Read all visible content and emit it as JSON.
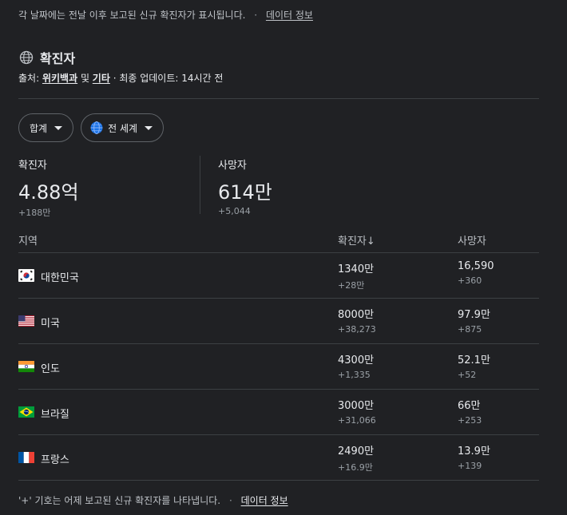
{
  "top_note": {
    "text": "각 날짜에는 전날 이후 보고된 신규 확진자가 표시됩니다.",
    "separator": "·",
    "link": "데이터 정보"
  },
  "header": {
    "icon": "globe-icon",
    "title": "확진자",
    "source_prefix": "출처: ",
    "source_link_1": "위키백과",
    "source_and": " 및 ",
    "source_link_2": "기타",
    "source_suffix": " · 최종 업데이트: 14시간 전"
  },
  "chips": {
    "total_label": "합계",
    "region_label": "전 세계"
  },
  "summary": {
    "cases": {
      "label": "확진자",
      "value": "4.88억",
      "delta": "+188만"
    },
    "deaths": {
      "label": "사망자",
      "value": "614만",
      "delta": "+5,044"
    }
  },
  "table": {
    "headers": {
      "region": "지역",
      "cases": "확진자↓",
      "deaths": "사망자"
    },
    "rows": [
      {
        "flag": "korea-flag-icon",
        "name": "대한민국",
        "cases": "1340만",
        "cases_delta": "+28만",
        "deaths": "16,590",
        "deaths_delta": "+360"
      },
      {
        "flag": "usa-flag-icon",
        "name": "미국",
        "cases": "8000만",
        "cases_delta": "+38,273",
        "deaths": "97.9만",
        "deaths_delta": "+875"
      },
      {
        "flag": "india-flag-icon",
        "name": "인도",
        "cases": "4300만",
        "cases_delta": "+1,335",
        "deaths": "52.1만",
        "deaths_delta": "+52"
      },
      {
        "flag": "brazil-flag-icon",
        "name": "브라질",
        "cases": "3000만",
        "cases_delta": "+31,066",
        "deaths": "66만",
        "deaths_delta": "+253"
      },
      {
        "flag": "france-flag-icon",
        "name": "프랑스",
        "cases": "2490만",
        "cases_delta": "+16.9만",
        "deaths": "13.9만",
        "deaths_delta": "+139"
      }
    ]
  },
  "footer": {
    "text": "'+' 기호는 어제 보고된 신규 확진자를 나타냅니다.",
    "separator": "·",
    "link": "데이터 정보"
  }
}
